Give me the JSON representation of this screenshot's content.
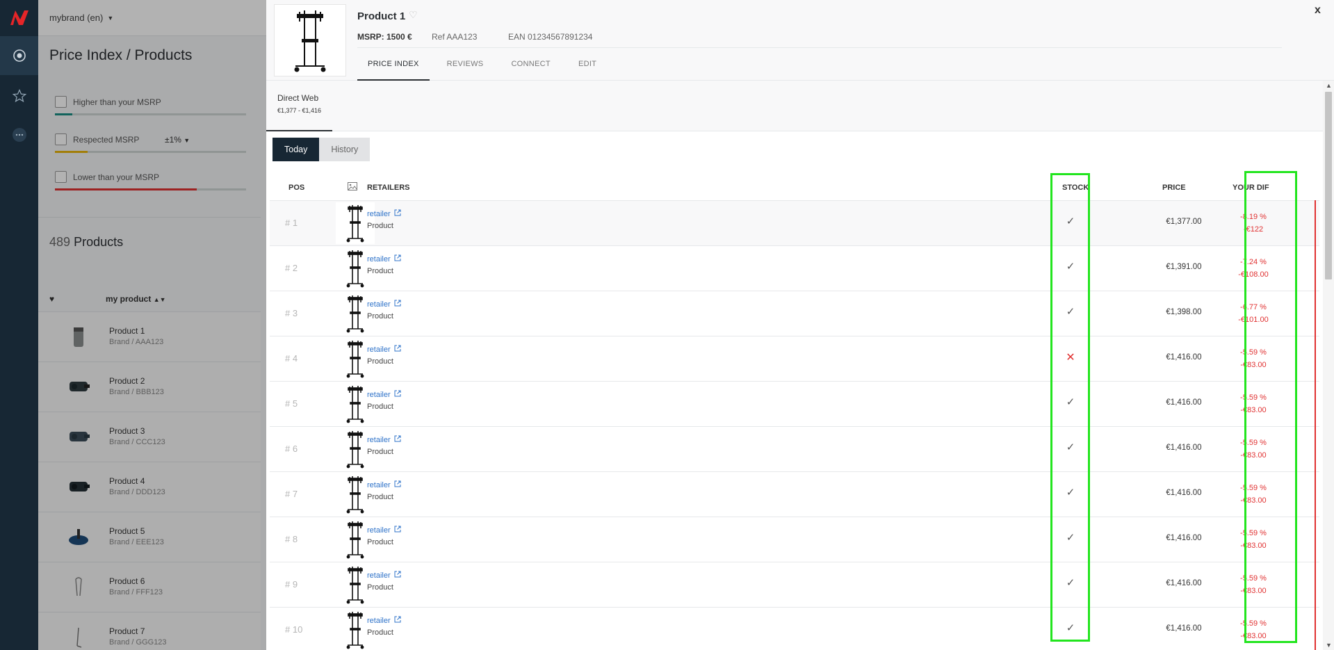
{
  "app": {
    "brand_selector": "mybrand (en)",
    "page_title": "Price Index / Products"
  },
  "filters": [
    {
      "label": "Higher than your MSRP",
      "color": "#1a8f84",
      "fill": 0.09
    },
    {
      "label": "Respected MSRP",
      "tolerance": "±1%",
      "color": "#e8b50e",
      "fill": 0.17
    },
    {
      "label": "Lower than your MSRP",
      "color": "#e03131",
      "fill": 0.74
    }
  ],
  "product_count": {
    "number": "489",
    "label": "Products"
  },
  "list_header": {
    "sort_label": "my product"
  },
  "products": [
    {
      "name": "Product 1",
      "brand": "Brand / AAA123"
    },
    {
      "name": "Product 2",
      "brand": "Brand / BBB123"
    },
    {
      "name": "Product 3",
      "brand": "Brand / CCC123"
    },
    {
      "name": "Product 4",
      "brand": "Brand / DDD123"
    },
    {
      "name": "Product 5",
      "brand": "Brand / EEE123"
    },
    {
      "name": "Product 6",
      "brand": "Brand / FFF123"
    },
    {
      "name": "Product 7",
      "brand": "Brand / GGG123"
    }
  ],
  "detail": {
    "title": "Product 1",
    "msrp": "MSRP: 1500 €",
    "ref": "Ref AAA123",
    "ean": "EAN 01234567891234",
    "close": "x",
    "tabs": [
      {
        "label": "PRICE INDEX",
        "active": true
      },
      {
        "label": "REVIEWS",
        "active": false
      },
      {
        "label": "CONNECT",
        "active": false
      },
      {
        "label": "EDIT",
        "active": false
      }
    ],
    "channel": {
      "name": "Direct Web",
      "range": "€1,377 - €1,416"
    },
    "segments": {
      "today": "Today",
      "history": "History"
    },
    "columns": {
      "pos": "POS",
      "retailers": "RETAILERS",
      "stock": "STOCK",
      "price": "PRICE",
      "diff": "YOUR DIF"
    },
    "rows": [
      {
        "pos": "# 1",
        "retailer": "retailer",
        "product": "Product",
        "in_stock": true,
        "price": "€1,377.00",
        "diff_pct": "-8.19 %",
        "diff_abs": "-€122"
      },
      {
        "pos": "# 2",
        "retailer": "retailer",
        "product": "Product",
        "in_stock": true,
        "price": "€1,391.00",
        "diff_pct": "-7.24 %",
        "diff_abs": "-€108.00"
      },
      {
        "pos": "# 3",
        "retailer": "retailer",
        "product": "Product",
        "in_stock": true,
        "price": "€1,398.00",
        "diff_pct": "-6.77 %",
        "diff_abs": "-€101.00"
      },
      {
        "pos": "# 4",
        "retailer": "retailer",
        "product": "Product",
        "in_stock": false,
        "price": "€1,416.00",
        "diff_pct": "-5.59 %",
        "diff_abs": "-€83.00"
      },
      {
        "pos": "# 5",
        "retailer": "retailer",
        "product": "Product",
        "in_stock": true,
        "price": "€1,416.00",
        "diff_pct": "-5.59 %",
        "diff_abs": "-€83.00"
      },
      {
        "pos": "# 6",
        "retailer": "retailer",
        "product": "Product",
        "in_stock": true,
        "price": "€1,416.00",
        "diff_pct": "-5.59 %",
        "diff_abs": "-€83.00"
      },
      {
        "pos": "# 7",
        "retailer": "retailer",
        "product": "Product",
        "in_stock": true,
        "price": "€1,416.00",
        "diff_pct": "-5.59 %",
        "diff_abs": "-€83.00"
      },
      {
        "pos": "# 8",
        "retailer": "retailer",
        "product": "Product",
        "in_stock": true,
        "price": "€1,416.00",
        "diff_pct": "-5.59 %",
        "diff_abs": "-€83.00"
      },
      {
        "pos": "# 9",
        "retailer": "retailer",
        "product": "Product",
        "in_stock": true,
        "price": "€1,416.00",
        "diff_pct": "-5.59 %",
        "diff_abs": "-€83.00"
      },
      {
        "pos": "# 10",
        "retailer": "retailer",
        "product": "Product",
        "in_stock": true,
        "price": "€1,416.00",
        "diff_pct": "-5.59 %",
        "diff_abs": "-€83.00"
      }
    ]
  },
  "icons": {
    "brand_logo": "logo-icon",
    "nav": [
      "target-icon",
      "star-icon",
      "more-icon"
    ],
    "stock_ok": "✓",
    "stock_no": "✕",
    "external": "external-link-icon",
    "heart": "♥",
    "favorite": "♡",
    "sort": "sort-icon"
  },
  "colors": {
    "rail": "#172734",
    "accent": "#172734",
    "link": "#2f73c9",
    "negative": "#e03131",
    "highlight": "#22e51e"
  }
}
